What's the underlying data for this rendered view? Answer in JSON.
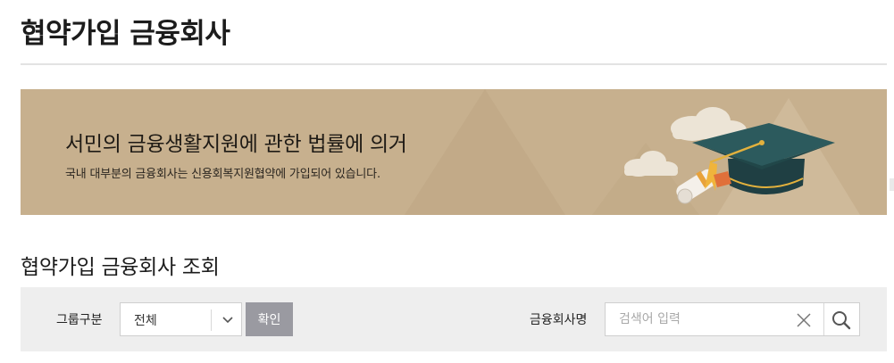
{
  "page": {
    "title": "협약가입 금융회사"
  },
  "banner": {
    "heading": "서민의 금융생활지원에 관한 법률에 의거",
    "subtext": "국내 대부분의 금융회사는 신용회복지원협약에 가입되어 있습니다.",
    "illustration": "graduation-cap-diploma-clouds",
    "background_color": "#c7b08e"
  },
  "section": {
    "title": "협약가입 금융회사 조회"
  },
  "search": {
    "group_label": "그룹구분",
    "group_selected": "전체",
    "confirm_label": "확인",
    "name_label": "금융회사명",
    "name_placeholder": "검색어 입력",
    "name_value": "",
    "clear_icon": "close-icon",
    "search_icon": "search-icon",
    "button_color": "#9a9aa1"
  }
}
